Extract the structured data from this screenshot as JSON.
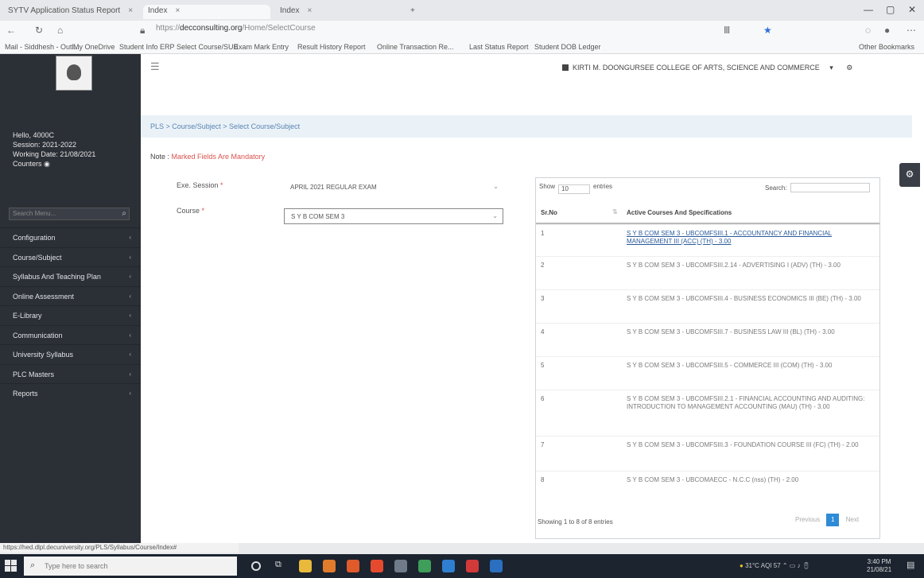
{
  "browser": {
    "tabs": [
      {
        "label": "SYTV Application Status Report",
        "active": false
      },
      {
        "label": "Index",
        "active": true
      },
      {
        "label": "Index",
        "active": false
      }
    ],
    "new_tab": "+",
    "url_prefix": "https://",
    "url_domain": "decconsulting.org",
    "url_rest": "/Home/SelectCourse",
    "bookmarks": [
      "Mail - Siddhesh - Outl...",
      "My OneDrive",
      "Student Info ERP",
      "Select Course/SUB",
      "Exam Mark Entry",
      "Result History Report",
      "Online Transaction Re...",
      "Last Status Report",
      "Student DOB Ledger"
    ],
    "other_bookmarks": "Other Bookmarks"
  },
  "sidebar": {
    "user_lines": [
      "Hello, 4000C",
      "Session: 2021-2022",
      "Working Date: 21/08/2021",
      "Counters"
    ],
    "search_placeholder": "Search Menu...",
    "items": [
      "Configuration",
      "Course/Subject",
      "Syllabus And Teaching Plan",
      "Online Assessment",
      "E-Library",
      "Communication",
      "University Syllabus",
      "PLC Masters",
      "Reports"
    ]
  },
  "topbar": {
    "college": "KIRTI M. DOONGURSEE COLLEGE OF ARTS, SCIENCE AND COMMERCE"
  },
  "breadcrumb": "PLS > Course/Subject > Select Course/Subject",
  "note": {
    "prefix": "Note :",
    "text": "Marked Fields Are Mandatory"
  },
  "form": {
    "exam_session_label": "Exe. Session",
    "exam_session_value": "APRIL 2021 REGULAR EXAM",
    "course_label": "Course",
    "course_value": "S Y B COM SEM 3"
  },
  "table": {
    "show_label": "Show",
    "show_value": "10",
    "entries_label": "entries",
    "search_label": "Search:",
    "col_no": "Sr.No",
    "col_course": "Active Courses And Specifications",
    "rows": [
      {
        "no": "1",
        "text": "S Y B COM SEM 3 - UBCOMFSIII.1 - ACCOUNTANCY AND FINANCIAL MANAGEMENT III (ACC) (TH) - 3.00"
      },
      {
        "no": "2",
        "text": "S Y B COM SEM 3 - UBCOMFSIII.2.14 - ADVERTISING I (ADV) (TH) - 3.00"
      },
      {
        "no": "3",
        "text": "S Y B COM SEM 3 - UBCOMFSIII.4 - BUSINESS ECONOMICS III (BE) (TH) - 3.00"
      },
      {
        "no": "4",
        "text": "S Y B COM SEM 3 - UBCOMFSIII.7 - BUSINESS LAW III (BL) (TH) - 3.00"
      },
      {
        "no": "5",
        "text": "S Y B COM SEM 3 - UBCOMFSIII.5 - COMMERCE III (COM) (TH) - 3.00"
      },
      {
        "no": "6",
        "text": "S Y B COM SEM 3 - UBCOMFSIII.2.1 - FINANCIAL ACCOUNTING AND AUDITING: INTRODUCTION TO MANAGEMENT ACCOUNTING (MAU) (TH) - 3.00"
      },
      {
        "no": "7",
        "text": "S Y B COM SEM 3 - UBCOMFSIII.3 - FOUNDATION COURSE III (FC) (TH) - 2.00"
      },
      {
        "no": "8",
        "text": "S Y B COM SEM 3 - UBCOMAECC - N.C.C (nss) (TH) - 2.00"
      }
    ],
    "info": "Showing 1 to 8 of 8 entries",
    "prev": "Previous",
    "page": "1",
    "next": "Next"
  },
  "status_url": "https://hed.dlpl.decuniversity.org/PLS/Syllabus/Course/Index#",
  "taskbar": {
    "search_placeholder": "Type here to search",
    "weather": "31°C AQI 57",
    "time": "3:40 PM",
    "date": "21/08/21"
  }
}
